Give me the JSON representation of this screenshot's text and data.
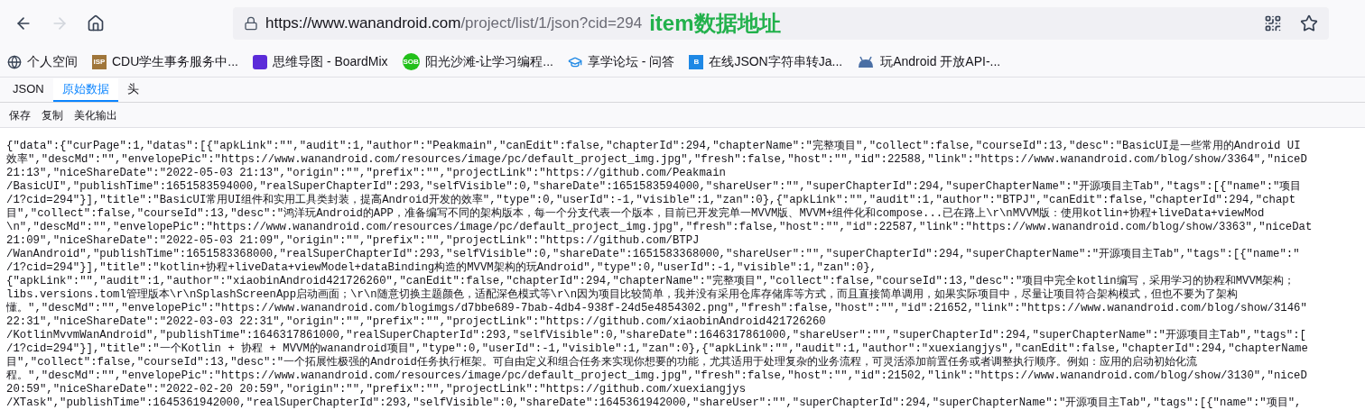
{
  "toolbar": {
    "back_disabled": false,
    "forward_disabled": true,
    "url_host": "https://www.wanandroid.com",
    "url_path": "/project/list/1/json?cid=294",
    "annotation": "item数据地址"
  },
  "bookmarks": [
    {
      "kind": "globe",
      "label": "个人空间"
    },
    {
      "kind": "badge",
      "badge": "ISP",
      "color": "#a0763a",
      "label": "CDU学生事务服务中..."
    },
    {
      "kind": "square",
      "color": "#5b2bd9",
      "label": "思维导图 - BoardMix"
    },
    {
      "kind": "circle",
      "badge": "SOB",
      "color": "#22c01a",
      "label": "阳光沙滩-让学习编程..."
    },
    {
      "kind": "cap",
      "label": "享学论坛 - 问答"
    },
    {
      "kind": "badge",
      "badge": "B",
      "color": "#1e88e5",
      "label": "在线JSON字符串转Ja..."
    },
    {
      "kind": "android",
      "label": "玩Android 开放API-..."
    }
  ],
  "tabs": [
    {
      "label": "JSON",
      "selected": false
    },
    {
      "label": "原始数据",
      "selected": true
    },
    {
      "label": "头",
      "selected": false
    }
  ],
  "actions": [
    "保存",
    "复制",
    "美化输出"
  ],
  "raw_lines": [
    "{\"data\":{\"curPage\":1,\"datas\":[{\"apkLink\":\"\",\"audit\":1,\"author\":\"Peakmain\",\"canEdit\":false,\"chapterId\":294,\"chapterName\":\"完整项目\",\"collect\":false,\"courseId\":13,\"desc\":\"BasicUI是一些常用的Android UI",
    "效率\",\"descMd\":\"\",\"envelopePic\":\"https://www.wanandroid.com/resources/image/pc/default_project_img.jpg\",\"fresh\":false,\"host\":\"\",\"id\":22588,\"link\":\"https://www.wanandroid.com/blog/show/3364\",\"niceD",
    "21:13\",\"niceShareDate\":\"2022-05-03 21:13\",\"origin\":\"\",\"prefix\":\"\",\"projectLink\":\"https://github.com/Peakmain",
    "/BasicUI\",\"publishTime\":1651583594000,\"realSuperChapterId\":293,\"selfVisible\":0,\"shareDate\":1651583594000,\"shareUser\":\"\",\"superChapterId\":294,\"superChapterName\":\"开源项目主Tab\",\"tags\":[{\"name\":\"项目",
    "/1?cid=294\"}],\"title\":\"BasicUI常用UI组件和实用工具类封装，提高Android开发的效率\",\"type\":0,\"userId\":-1,\"visible\":1,\"zan\":0},{\"apkLink\":\"\",\"audit\":1,\"author\":\"BTPJ\",\"canEdit\":false,\"chapterId\":294,\"chapt",
    "目\",\"collect\":false,\"courseId\":13,\"desc\":\"鸿洋玩Android的APP，准备编写不同的架构版本，每一个分支代表一个版本，目前已开发完单一MVVM版、MVVM+组件化和compose...已在路上\\r\\nMVVM版：使用kotlin+协程+liveData+viewMod",
    "\\n\",\"descMd\":\"\",\"envelopePic\":\"https://www.wanandroid.com/resources/image/pc/default_project_img.jpg\",\"fresh\":false,\"host\":\"\",\"id\":22587,\"link\":\"https://www.wanandroid.com/blog/show/3363\",\"niceDat",
    "21:09\",\"niceShareDate\":\"2022-05-03 21:09\",\"origin\":\"\",\"prefix\":\"\",\"projectLink\":\"https://github.com/BTPJ",
    "/WanAndroid\",\"publishTime\":1651583368000,\"realSuperChapterId\":293,\"selfVisible\":0,\"shareDate\":1651583368000,\"shareUser\":\"\",\"superChapterId\":294,\"superChapterName\":\"开源项目主Tab\",\"tags\":[{\"name\":\"",
    "/1?cid=294\"}],\"title\":\"kotlin+协程+liveData+viewModel+dataBinding构造的MVVM架构的玩Android\",\"type\":0,\"userId\":-1,\"visible\":1,\"zan\":0},",
    "{\"apkLink\":\"\",\"audit\":1,\"author\":\"xiaobinAndroid421726260\",\"canEdit\":false,\"chapterId\":294,\"chapterName\":\"完整项目\",\"collect\":false,\"courseId\":13,\"desc\":\"项目中完全kotlin编写，采用学习的协程和MVVM架构；",
    "libs.versions.toml管理版本\\r\\nSplashScreenApp启动画面；\\r\\n随意切换主题颜色，适配深色模式等\\r\\n因为项目比较简单，我并没有采用仓库存储库等方式，而且直接简单调用，如果实际项目中，尽量让项目符合架构模式，但也不要为了架构",
    "懂。\",\"descMd\":\"\",\"envelopePic\":\"https://www.wanandroid.com/blogimgs/d7bbe689-7bab-4db4-938f-24d5e4854302.png\",\"fresh\":false,\"host\":\"\",\"id\":21652,\"link\":\"https://www.wanandroid.com/blog/show/3146\"",
    "22:31\",\"niceShareDate\":\"2022-03-03 22:31\",\"origin\":\"\",\"prefix\":\"\",\"projectLink\":\"https://github.com/xiaobinAndroid421726260",
    "/KotlinMvvmWanAndroid\",\"publishTime\":1646317861000,\"realSuperChapterId\":293,\"selfVisible\":0,\"shareDate\":1646317861000,\"shareUser\":\"\",\"superChapterId\":294,\"superChapterName\":\"开源项目主Tab\",\"tags\":[",
    "/1?cid=294\"}],\"title\":\"一个Kotlin + 协程 + MVVM的wanandroid项目\",\"type\":0,\"userId\":-1,\"visible\":1,\"zan\":0},{\"apkLink\":\"\",\"audit\":1,\"author\":\"xuexiangjys\",\"canEdit\":false,\"chapterId\":294,\"chapterName",
    "目\",\"collect\":false,\"courseId\":13,\"desc\":\"一个拓展性极强的Android任务执行框架。可自由定义和组合任务来实现你想要的功能，尤其适用于处理复杂的业务流程，可灵活添加前置任务或者调整执行顺序。例如：应用的启动初始化流",
    "程。\",\"descMd\":\"\",\"envelopePic\":\"https://www.wanandroid.com/resources/image/pc/default_project_img.jpg\",\"fresh\":false,\"host\":\"\",\"id\":21502,\"link\":\"https://www.wanandroid.com/blog/show/3130\",\"niceD",
    "20:59\",\"niceShareDate\":\"2022-02-20 20:59\",\"origin\":\"\",\"prefix\":\"\",\"projectLink\":\"https://github.com/xuexiangjys",
    "/XTask\",\"publishTime\":1645361942000,\"realSuperChapterId\":293,\"selfVisible\":0,\"shareDate\":1645361942000,\"shareUser\":\"\",\"superChapterId\":294,\"superChapterName\":\"开源项目主Tab\",\"tags\":[{\"name\":\"项目\","
  ]
}
